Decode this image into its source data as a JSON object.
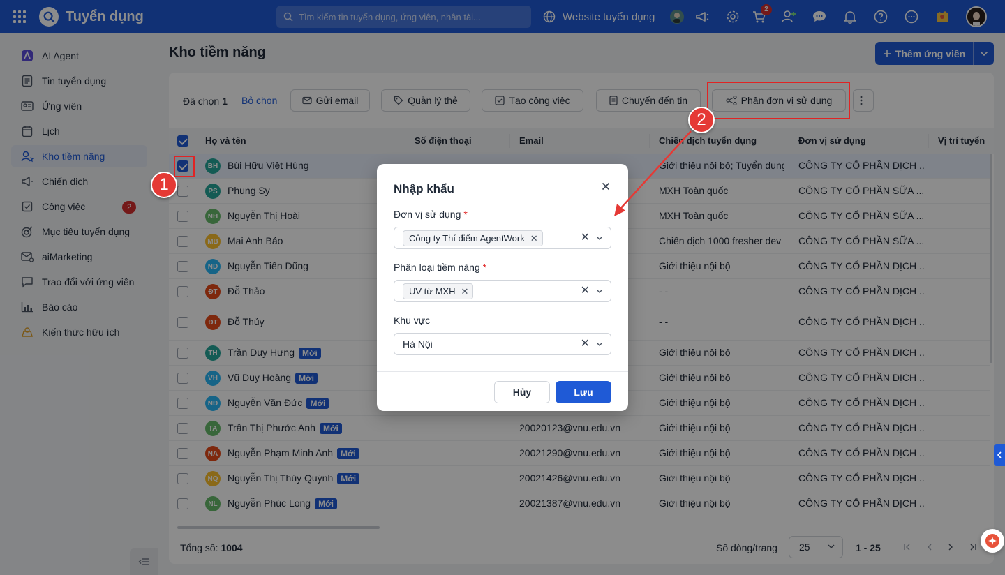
{
  "topbar": {
    "app_title": "Tuyển dụng",
    "search_placeholder": "Tìm kiếm tin tuyển dụng, ứng viên, nhân tài...",
    "website_label": "Website tuyển dụng",
    "cart_badge": "2",
    "brand_color": "#1f5ad6"
  },
  "sidebar": {
    "items": [
      {
        "label": "AI Agent",
        "icon": "ai-agent-icon"
      },
      {
        "label": "Tin tuyển dụng",
        "icon": "document-icon"
      },
      {
        "label": "Ứng viên",
        "icon": "id-card-icon"
      },
      {
        "label": "Lịch",
        "icon": "calendar-icon"
      },
      {
        "label": "Kho tiềm năng",
        "icon": "talent-pool-icon"
      },
      {
        "label": "Chiến dịch",
        "icon": "megaphone-icon"
      },
      {
        "label": "Công việc",
        "icon": "task-icon",
        "badge": "2"
      },
      {
        "label": "Mục tiêu tuyển dụng",
        "icon": "target-icon"
      },
      {
        "label": "aiMarketing",
        "icon": "mail-settings-icon"
      },
      {
        "label": "Trao đổi với ứng viên",
        "icon": "chat-icon"
      },
      {
        "label": "Báo cáo",
        "icon": "chart-icon"
      },
      {
        "label": "Kiến thức hữu ích",
        "icon": "lightbulb-icon"
      }
    ]
  },
  "page": {
    "title": "Kho tiềm năng",
    "add_button": "Thêm ứng viên"
  },
  "toolbar": {
    "selected_label": "Đã chọn",
    "selected_count": "1",
    "unselect": "Bỏ chọn",
    "send_email": "Gửi email",
    "manage_tags": "Quản lý thẻ",
    "create_task": "Tạo công việc",
    "move_to_job": "Chuyển đến tin",
    "assign_unit": "Phân đơn vị sử dụng"
  },
  "table": {
    "columns": [
      "Họ và tên",
      "Số điện thoại",
      "Email",
      "Chiến dịch tuyển dụng",
      "Đơn vị sử dụng",
      "Vị trí tuyển"
    ],
    "new_tag": "Mới",
    "rows": [
      {
        "initials": "BH",
        "color": "#26a69a",
        "name": "Bùi Hữu Việt Hùng",
        "new": false,
        "email": "",
        "campaign": "Giới thiệu nội bộ; Tuyển dụng",
        "unit": "CÔNG TY CỔ PHẦN DỊCH ..."
      },
      {
        "initials": "PS",
        "color": "#26a69a",
        "name": "Phung Sy",
        "new": false,
        "email": "",
        "campaign": "MXH Toàn quốc",
        "unit": "CÔNG TY CỔ PHẦN SỮA ..."
      },
      {
        "initials": "NH",
        "color": "#66bb6a",
        "name": "Nguyễn Thị Hoài",
        "new": false,
        "email": "",
        "campaign": "MXH Toàn quốc",
        "unit": "CÔNG TY CỔ PHẦN SỮA ..."
      },
      {
        "initials": "MB",
        "color": "#fbc02d",
        "name": "Mai Anh Bảo",
        "new": false,
        "email": "",
        "campaign": "Chiến dịch 1000 fresher dev",
        "unit": "CÔNG TY CỔ PHẦN SỮA ..."
      },
      {
        "initials": "ND",
        "color": "#29b6f6",
        "name": "Nguyễn Tiến Dũng",
        "new": false,
        "email": "",
        "campaign": "Giới thiệu nội bộ",
        "unit": "CÔNG TY CỔ PHẦN DỊCH ..."
      },
      {
        "initials": "ĐT",
        "color": "#e64a19",
        "name": "Đỗ Thảo",
        "new": false,
        "email": "",
        "campaign": "- -",
        "unit": "CÔNG TY CỔ PHẦN DỊCH ..."
      },
      {
        "initials": "ĐT",
        "color": "#e64a19",
        "name": "Đỗ Thủy",
        "new": false,
        "email": "",
        "campaign": "- -",
        "unit": "CÔNG TY CỔ PHẦN DỊCH ..."
      },
      {
        "initials": "TH",
        "color": "#26a69a",
        "name": "Trần Duy Hưng",
        "new": true,
        "email": "",
        "campaign": "Giới thiệu nội bộ",
        "unit": "CÔNG TY CỔ PHẦN DỊCH ..."
      },
      {
        "initials": "VH",
        "color": "#29b6f6",
        "name": "Vũ Duy Hoàng",
        "new": true,
        "email": "",
        "campaign": "Giới thiệu nội bộ",
        "unit": "CÔNG TY CỔ PHẦN DỊCH ..."
      },
      {
        "initials": "NĐ",
        "color": "#29b6f6",
        "name": "Nguyễn Văn Đức",
        "new": true,
        "email": "",
        "campaign": "Giới thiệu nội bộ",
        "unit": "CÔNG TY CỔ PHẦN DỊCH ..."
      },
      {
        "initials": "TA",
        "color": "#66bb6a",
        "name": "Trần Thị Phước Anh",
        "new": true,
        "email": "20020123@vnu.edu.vn",
        "campaign": "Giới thiệu nội bộ",
        "unit": "CÔNG TY CỔ PHẦN DỊCH ..."
      },
      {
        "initials": "NA",
        "color": "#e64a19",
        "name": "Nguyễn Phạm Minh Anh",
        "new": true,
        "email": "20021290@vnu.edu.vn",
        "campaign": "Giới thiệu nội bộ",
        "unit": "CÔNG TY CỔ PHẦN DỊCH ..."
      },
      {
        "initials": "NQ",
        "color": "#fbc02d",
        "name": "Nguyễn Thị Thúy Quỳnh",
        "new": true,
        "email": "20021426@vnu.edu.vn",
        "campaign": "Giới thiệu nội bộ",
        "unit": "CÔNG TY CỔ PHẦN DỊCH ..."
      },
      {
        "initials": "NL",
        "color": "#66bb6a",
        "name": "Nguyễn Phúc Long",
        "new": true,
        "email": "20021387@vnu.edu.vn",
        "campaign": "Giới thiệu nội bộ",
        "unit": "CÔNG TY CỔ PHẦN DỊCH ..."
      }
    ]
  },
  "footer": {
    "total_label": "Tổng số:",
    "total_value": "1004",
    "rows_per_page_label": "Số dòng/trang",
    "rows_per_page": "25",
    "range": "1 - 25"
  },
  "modal": {
    "title": "Nhập khẩu",
    "unit_label": "Đơn vị sử dụng",
    "unit_value": "Công ty Thí điểm AgentWork",
    "category_label": "Phân loại tiềm năng",
    "category_value": "UV từ MXH",
    "region_label": "Khu vực",
    "region_value": "Hà Nội",
    "required_mark": "*",
    "cancel": "Hủy",
    "save": "Lưu"
  },
  "annotations": {
    "step1": "1",
    "step2": "2",
    "highlight_color": "#e02424"
  }
}
